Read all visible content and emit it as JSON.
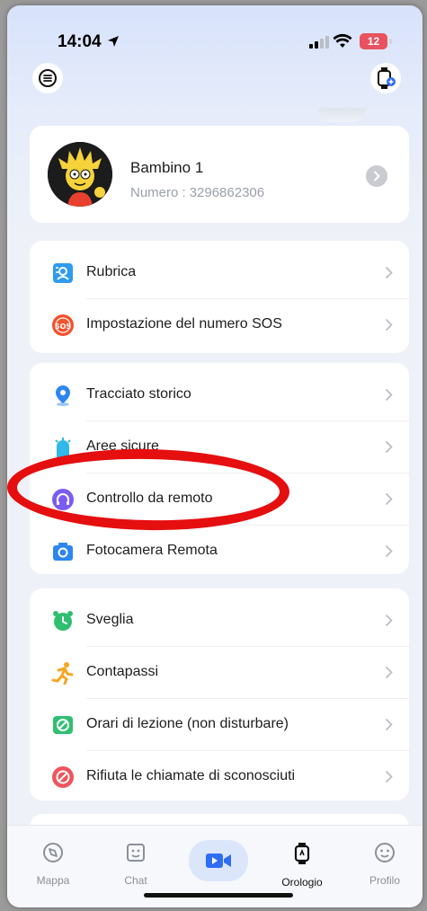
{
  "status_bar": {
    "time": "14:04",
    "battery": "12"
  },
  "profile": {
    "name": "Bambino 1",
    "number_label": "Numero :",
    "number_value": "3296862306"
  },
  "menu_groups": [
    {
      "items": [
        {
          "label": "Rubrica",
          "icon": "contacts-icon"
        },
        {
          "label": "Impostazione del numero SOS",
          "icon": "sos-icon"
        }
      ]
    },
    {
      "items": [
        {
          "label": "Tracciato storico",
          "icon": "location-pin-icon"
        },
        {
          "label": "Aree sicure",
          "icon": "safe-area-icon"
        },
        {
          "label": "Controllo da remoto",
          "icon": "remote-listen-icon"
        },
        {
          "label": "Fotocamera Remota",
          "icon": "camera-icon"
        }
      ]
    },
    {
      "items": [
        {
          "label": "Sveglia",
          "icon": "alarm-clock-icon"
        },
        {
          "label": "Contapassi",
          "icon": "pedometer-icon"
        },
        {
          "label": "Orari di lezione (non disturbare)",
          "icon": "do-not-disturb-icon"
        },
        {
          "label": "Rifiuta le chiamate di sconosciuti",
          "icon": "block-calls-icon"
        }
      ]
    }
  ],
  "tabs": [
    {
      "label": "Mappa",
      "icon": "compass-icon"
    },
    {
      "label": "Chat",
      "icon": "chat-icon"
    },
    {
      "label": "",
      "icon": "video-call-icon"
    },
    {
      "label": "Orologio",
      "icon": "watch-icon"
    },
    {
      "label": "Profilo",
      "icon": "smiley-icon"
    }
  ],
  "colors": {
    "highlight": "#e50f10",
    "accent": "#2f6df3",
    "battery": "#e9525f"
  }
}
